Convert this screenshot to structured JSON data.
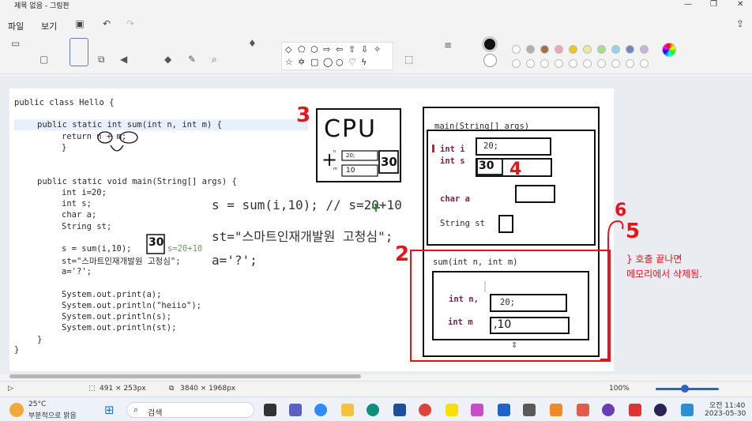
{
  "window": {
    "title": "제목 없음 - 그림판"
  },
  "menu": {
    "file": "파일",
    "view": "보기"
  },
  "code": {
    "line1": "public class Hello {",
    "line2": "public static int sum(int n, int m) {",
    "line3": "return n + m;",
    "line4": "}",
    "line5": "public static void main(String[] args) {",
    "line6": "int i=20;",
    "line7": "int s;",
    "line8": "char a;",
    "line9": "String st;",
    "line10": "s = sum(i,10);",
    "line10b": "s=20+10",
    "line11": "st=\"스마트인재개발원 고청심\";",
    "line12": "a='?';",
    "line13": "System.out.print(a);",
    "line14": "System.out.println(\"heiio\");",
    "line15": "System.out.println(s);",
    "line16": "System.out.println(st);",
    "line17": "}",
    "line18": "}"
  },
  "big_code": {
    "l1": "s = sum(i,10); // s=20+10",
    "l2": "st=\"스마트인재개발원 고청심\";",
    "l3": "a='?';"
  },
  "cpu": {
    "label": "CPU",
    "plus": "+",
    "val1": "20;",
    "val2": "10",
    "result": "30",
    "n_label": "n",
    "m_label": "m"
  },
  "memory_main": {
    "header": "main(String[] args)",
    "int_i": "int i",
    "int_i_val": "20;",
    "int_s": "int s",
    "int_s_val": "30",
    "char_a": "char a",
    "string_st": "String st"
  },
  "memory_sum": {
    "header": "sum(int n, int m)",
    "int_n": "int n,",
    "int_n_val": "20;",
    "int_m": "int m",
    "int_m_val": ",10"
  },
  "annotations": {
    "step2": "2",
    "step3": "3",
    "step4": "4",
    "step5": "5",
    "step6": "6",
    "note_line1": "} 호출 끝나면",
    "note_line2": "메모리에서 삭제됨.",
    "handwritten_30": "30"
  },
  "statusbar": {
    "selection": "491 × 253px",
    "canvas_size": "3840 × 1968px",
    "zoom": "100%"
  },
  "taskbar": {
    "weather_temp": "25°C",
    "weather_desc": "부분적으로 맑음",
    "search_placeholder": "검색",
    "time_label": "오전 11:40",
    "date": "2023-05-30"
  },
  "colors": {
    "red": "#e8141c",
    "black": "#111111",
    "keyword": "#7a1e4a"
  }
}
